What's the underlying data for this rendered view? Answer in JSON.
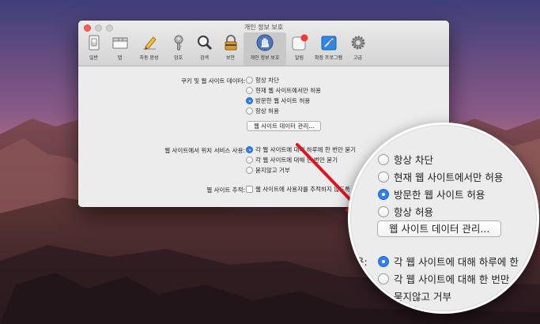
{
  "window": {
    "title": "개인 정보 보호",
    "toolbar": [
      {
        "label": "일반",
        "icon": "general-switch-icon"
      },
      {
        "label": "탭",
        "icon": "tabs-icon"
      },
      {
        "label": "자동 완성",
        "icon": "autofill-pencil-icon"
      },
      {
        "label": "암호",
        "icon": "key-icon"
      },
      {
        "label": "검색",
        "icon": "magnifying-glass-icon"
      },
      {
        "label": "보안",
        "icon": "lock-icon"
      },
      {
        "label": "개인 정보 보호",
        "icon": "hand-icon",
        "selected": true
      },
      {
        "label": "알림",
        "icon": "notification-icon"
      },
      {
        "label": "확장 프로그램",
        "icon": "puzzle-compass-icon"
      },
      {
        "label": "고급",
        "icon": "gear-icon"
      }
    ]
  },
  "cookies": {
    "label": "쿠키 및 웹 사이트 데이터:",
    "options": [
      {
        "label": "항상 차단",
        "selected": false
      },
      {
        "label": "현재 웹 사이트에서만 허용",
        "selected": false
      },
      {
        "label": "방문한 웹 사이트 허용",
        "selected": true
      },
      {
        "label": "항상 허용",
        "selected": false
      }
    ],
    "manage_button": "웹 사이트 데이터 관리..."
  },
  "location": {
    "label": "웹 사이트에서 위치 서비스 사용:",
    "options": [
      {
        "label": "각 웹 사이트에 대해 하루에 한 번만 묻기",
        "selected": true
      },
      {
        "label": "각 웹 사이트에 대해 한 번만 묻기",
        "selected": false
      },
      {
        "label": "묻지않고 거부",
        "selected": false
      }
    ]
  },
  "tracking": {
    "label": "웹 사이트 추적:",
    "checkbox_label": "웹 사이트에 사용자를 추적하지 않도록 요청",
    "checked": false
  },
  "magnifier": {
    "cookie_options": [
      "항상 차단",
      "현재 웹 사이트에서만 허용",
      "방문한 웹 사이트 허용",
      "항상 허용"
    ],
    "manage_button": "웹 사이트 데이터 관리...",
    "location_label_tail": "용:",
    "location_options": [
      "각 웹 사이트에 대해 하루에 한",
      "각 웹 사이트에 대해 한 번만",
      "묻지않고 거부"
    ]
  },
  "colors": {
    "accent": "#2f7ff6",
    "arrow": "#e0141c"
  }
}
